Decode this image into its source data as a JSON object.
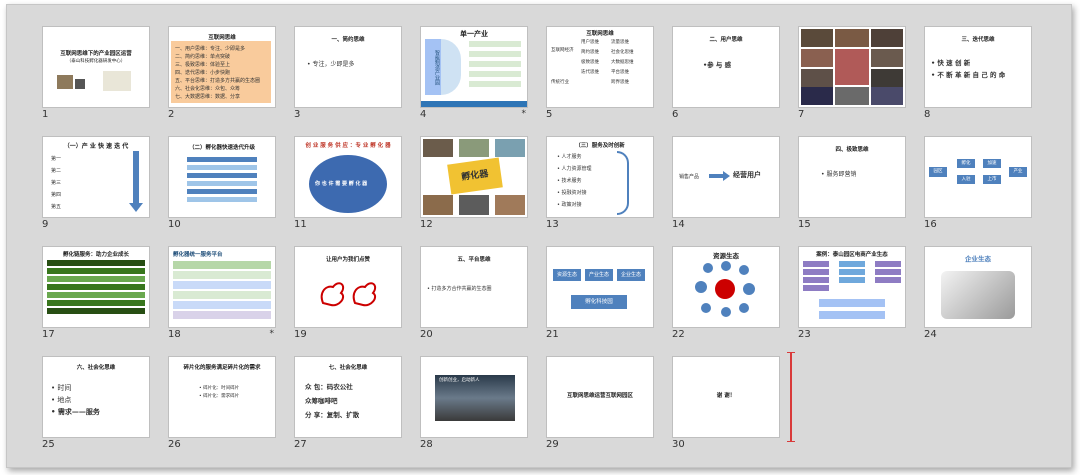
{
  "colors": {
    "background": "#d9d9d9",
    "slide": "#ffffff",
    "accent_blue": "#4f81bd",
    "cursor": "#d93a3a"
  },
  "slides": [
    {
      "num": "1",
      "title": "互联网思维下的产业园区运营",
      "sub": "（泰山科技孵化器研发中心）",
      "star": ""
    },
    {
      "num": "2",
      "title": "互联网思维",
      "lines": [
        "一、用户思维：专注、少即是多",
        "二、简约思维：单点突破",
        "三、极致思维：体验至上",
        "四、迭代思维：小步快跑",
        "五、平台思维：打造多方共赢的生态圈",
        "六、社会化思维：众包、众筹",
        "七、大数据思维：数据、分享"
      ],
      "star": ""
    },
    {
      "num": "3",
      "title": "一、简约思维",
      "line": "• 专注，少即是多",
      "star": ""
    },
    {
      "num": "4",
      "title": "单一产业",
      "side": "智能制造产业园",
      "star": "*"
    },
    {
      "num": "5",
      "title": "互联网思维",
      "items": [
        "互联网经济",
        "传统行业",
        "用户思维",
        "简约思维",
        "极致思维",
        "迭代思维",
        "流量思维",
        "社会化思维",
        "大数据思维",
        "平台思维",
        "跨界思维"
      ],
      "star": ""
    },
    {
      "num": "6",
      "title": "二、用户思维",
      "line": "•参 与 感",
      "star": ""
    },
    {
      "num": "7",
      "star": ""
    },
    {
      "num": "8",
      "title": "三、迭代思维",
      "lines": [
        "• 快 速 创 新",
        "• 不 断 革 新 自 己 的 命"
      ],
      "star": ""
    },
    {
      "num": "9",
      "title": "（一）产 业 快 速 迭 代",
      "lines": [
        "第一",
        "第二",
        "第三",
        "第四",
        "第五"
      ],
      "star": ""
    },
    {
      "num": "10",
      "title": "（二）孵化器快速迭代升级",
      "star": ""
    },
    {
      "num": "11",
      "title": "创 业 服 务 供 应 ：专 业 孵 化 器",
      "center": "你 也 许 需 要 孵 化 器",
      "star": ""
    },
    {
      "num": "12",
      "center": "孵化器",
      "star": ""
    },
    {
      "num": "13",
      "title": "（三）服务及时创新",
      "lines": [
        "• 人才服务",
        "• 人力资源管理",
        "• 技术服务",
        "• 投融资对接",
        "• 政策对接"
      ],
      "star": ""
    },
    {
      "num": "14",
      "left": "销售产品",
      "right": "经营用户",
      "star": ""
    },
    {
      "num": "15",
      "title": "四、极致思维",
      "line": "• 服务即营销",
      "star": ""
    },
    {
      "num": "16",
      "boxes": [
        "园区",
        "孵化",
        "加速",
        "入驻",
        "上市",
        "产业"
      ],
      "star": ""
    },
    {
      "num": "17",
      "title": "孵化链服务：助力企业成长",
      "star": ""
    },
    {
      "num": "18",
      "title": "孵化器统一服务平台",
      "star": "*"
    },
    {
      "num": "19",
      "title": "让用户为我们点赞",
      "star": ""
    },
    {
      "num": "20",
      "title": "五、平台思维",
      "line": "• 打造多方合作共赢的生态圈",
      "star": ""
    },
    {
      "num": "21",
      "boxes": [
        "资源生态",
        "产业生态",
        "企业生态"
      ],
      "bottom": "孵化科技园",
      "star": ""
    },
    {
      "num": "22",
      "title": "资源生态",
      "star": ""
    },
    {
      "num": "23",
      "title": "案例：泰山园区电商产业生态",
      "star": ""
    },
    {
      "num": "24",
      "title": "企业生态",
      "star": ""
    },
    {
      "num": "25",
      "title": "六、社会化思维",
      "lines": [
        "• 时间",
        "• 地点",
        "• 需求——服务"
      ],
      "star": ""
    },
    {
      "num": "26",
      "title": "碎片化的服务满足碎片化的需求",
      "lines": [
        "• 碎片化：时间碎片",
        "• 碎片化：需求碎片"
      ],
      "star": ""
    },
    {
      "num": "27",
      "title": "七、社会化思维",
      "lines": [
        "众 包：码农公社",
        "      众筹咖啡吧",
        "分 享：复制、扩散"
      ],
      "star": ""
    },
    {
      "num": "28",
      "caption": "创新创业，启动新人",
      "star": ""
    },
    {
      "num": "29",
      "center": "互联网思维运营互联网园区",
      "star": ""
    },
    {
      "num": "30",
      "center": "谢 谢！",
      "star": ""
    }
  ]
}
